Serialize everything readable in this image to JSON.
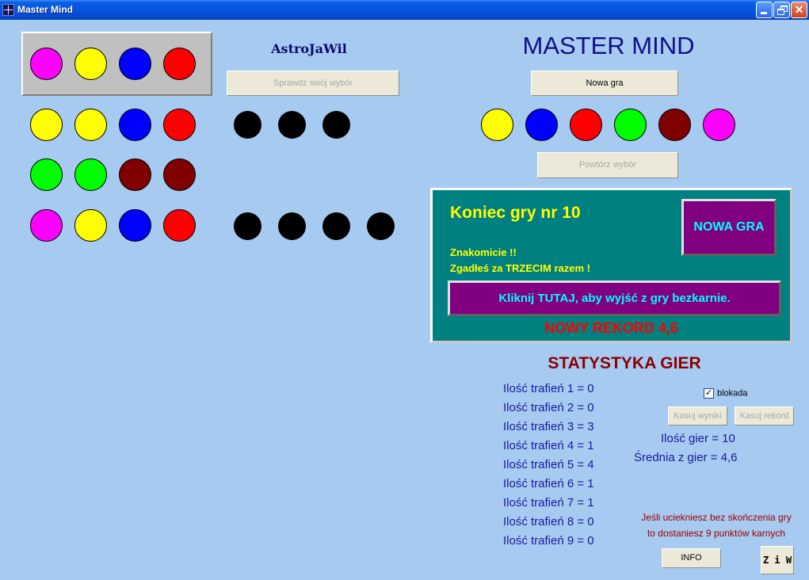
{
  "window": {
    "title": "Master Mind"
  },
  "colors": {
    "magenta": "#ff00ff",
    "yellow": "#ffff00",
    "blue": "#0000ff",
    "red": "#ff0000",
    "green": "#00ff00",
    "maroon": "#800000",
    "black": "#000000",
    "teal_panel": "#008080",
    "purple_button": "#800080"
  },
  "selection": [
    "magenta",
    "yellow",
    "blue",
    "red"
  ],
  "author_label": "AstroJaWil",
  "check_button_label": "Sprawdź swój wybór",
  "guesses": [
    {
      "balls": [
        "yellow",
        "yellow",
        "blue",
        "red"
      ],
      "black_pegs": 3
    },
    {
      "balls": [
        "green",
        "green",
        "maroon",
        "maroon"
      ],
      "black_pegs": 0
    },
    {
      "balls": [
        "magenta",
        "yellow",
        "blue",
        "red"
      ],
      "black_pegs": 4
    }
  ],
  "app_title": "MASTER MIND",
  "new_game_label": "Nowa gra",
  "palette": [
    "yellow",
    "blue",
    "red",
    "green",
    "maroon",
    "magenta"
  ],
  "repeat_button_label": "Powtórz wybór",
  "end_panel": {
    "title": "Koniec gry nr 10",
    "new_game_button": "NOWA GRA",
    "message_line1": "Znakomicie !!",
    "message_line2": "Zgadłeś za TRZECIM razem !",
    "exit_button": "Kliknij TUTAJ, aby wyjść z gry bezkarnie.",
    "record": "NOWY  REKORD  4,6"
  },
  "stats": {
    "title": "STATYSTYKA GIER",
    "lines": [
      "Ilość trafień 1 = 0",
      "Ilość trafień 2 = 0",
      "Ilość trafień 3 = 3",
      "Ilość trafień 4 = 1",
      "Ilość trafień 5 = 4",
      "Ilość trafień 6 = 1",
      "Ilość trafień 7 = 1",
      "Ilość trafień 8 = 0",
      "Ilość trafień 9 = 0"
    ],
    "lock_label": "blokada",
    "lock_checked": true,
    "clear_results_label": "Kasuj wyniki",
    "clear_record_label": "Kasuj rekord",
    "games_count": "Ilość gier  = 10",
    "average": "Średnia z gier  = 4,6"
  },
  "warning_line1": "Jeśli uciekniesz bez skończenia gry",
  "warning_line2": "to dostaniesz 9 punktów karnych",
  "info_label": "INFO",
  "ziw_label": "Z i W"
}
